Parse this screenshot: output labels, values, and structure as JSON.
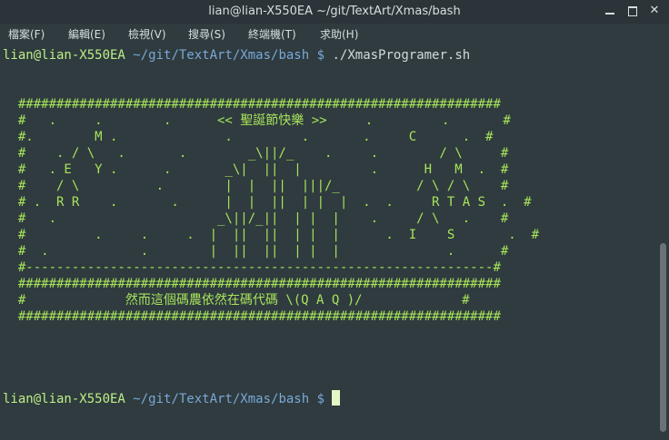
{
  "window": {
    "title": "lian@lian-X550EA ~/git/TextArt/Xmas/bash",
    "minimize_icon": "minimize-icon",
    "maximize_icon": "maximize-icon",
    "close_icon": "close-icon",
    "close_glyph": "✕"
  },
  "menu": [
    {
      "label": "檔案(F)"
    },
    {
      "label": "編輯(E)"
    },
    {
      "label": "檢視(V)"
    },
    {
      "label": "搜尋(S)"
    },
    {
      "label": "終端機(T)"
    },
    {
      "label": "求助(H)"
    }
  ],
  "terminal": {
    "prompt1": {
      "user": "lian@lian-X550EA",
      "path": "~/git/TextArt/Xmas/bash",
      "symbol": "$",
      "command": "./XmasProgramer.sh"
    },
    "art": [
      "",
      "",
      "  ###############################################################",
      "  #   .     .        .      << 聖誕節快樂 >>     .         .       #",
      "  #.        M .              .         .       .     C      .  #",
      "  #    . / \\   .       .        _\\||/_    .     .        / \\     #",
      "  #   . E   Y .      .       _\\|  ||  |         .      H   M  .  #",
      "  #    / \\          .        |  |  ||  |||/_          / \\ / \\    #",
      "  # .  R R    .       .      |  |  ||  | |  |  .  .     R T A S  .  #",
      "  #   .                     _\\||/_||  | |  |    .     / \\   .    #",
      "  #         .     .     .  |  ||  ||  | |  |      .  I    S       .  #",
      "  #  .            .        |  ||  ||  | |  |              .      #",
      "  #-------------------------------------------------------------#",
      "  ###############################################################",
      "  #             然而這個碼農依然在碼代碼 \\(Q A Q )/             #",
      "  ###############################################################",
      "",
      "",
      ""
    ],
    "prompt2": {
      "user": "lian@lian-X550EA",
      "path": "~/git/TextArt/Xmas/bash",
      "symbol": "$"
    }
  }
}
